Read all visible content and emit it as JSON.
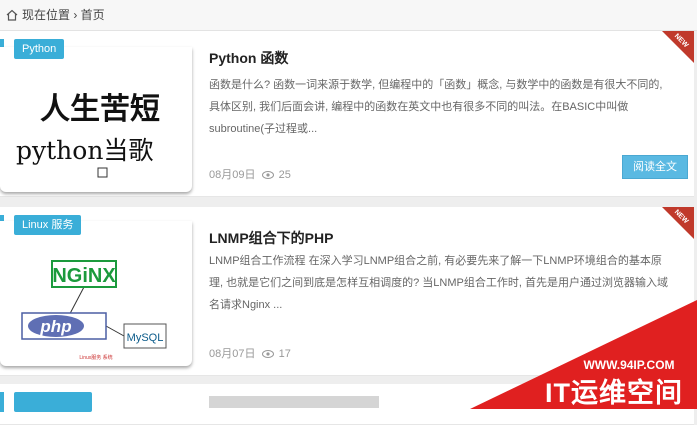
{
  "breadcrumb": {
    "text": "现在位置 › 首页"
  },
  "posts": [
    {
      "category": "Python",
      "thumb_line1": "人生苦短",
      "thumb_line2": "python当歌",
      "title": "Python 函数",
      "excerpt": "函数是什么? 函数一词来源于数学, 但编程中的「函数」概念, 与数学中的函数是有很大不同的, 具体区别, 我们后面会讲, 编程中的函数在英文中也有很多不同的叫法。在BASIC中叫做subroutine(子过程或...",
      "date": "08月09日",
      "views": "25",
      "readmore": "阅读全文",
      "badge": "NEW"
    },
    {
      "category": "Linux 服务",
      "thumb_nginx": "NGiNX",
      "thumb_php": "php",
      "thumb_mysql": "MySQL",
      "thumb_caption": "Linux服务 系统",
      "title": "LNMP组合下的PHP",
      "excerpt": "LNMP组合工作流程 在深入学习LNMP组合之前, 有必要先来了解一下LNMP环境组合的基本原理, 也就是它们之间到底是怎样互相调度的? 当LNMP组合工作时, 首先是用户通过浏览器输入域名请求Nginx ...",
      "date": "08月07日",
      "views": "17",
      "badge": "NEW"
    }
  ],
  "watermark": {
    "url": "WWW.94IP.COM",
    "text": "IT运维空间"
  },
  "colors": {
    "accent": "#3aaed8",
    "ribbon": "#c0392b",
    "watermark": "#e02020"
  }
}
